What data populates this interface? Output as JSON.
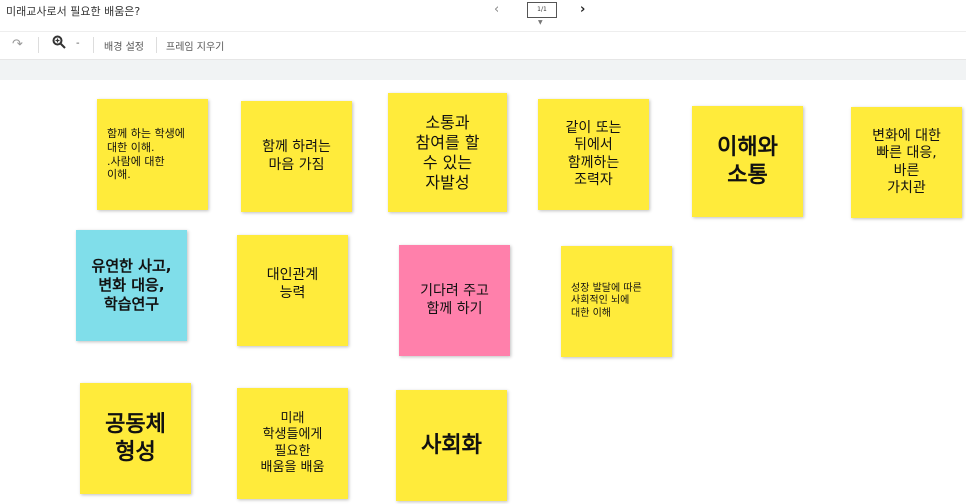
{
  "header": {
    "title": "미래교사로서 필요한 배움은?",
    "page_indicator": "1/1"
  },
  "toolbar": {
    "redo_icon": "redo-icon",
    "zoom_icon": "zoom-icon",
    "zoom_minus": "-",
    "background_label": "배경 설정",
    "clear_frame_label": "프레임 지우기"
  },
  "notes": [
    {
      "id": "n1",
      "text": "함께 하는 학생에\n대한 이해.\n.사람에 대한\n이해.",
      "color": "yellow"
    },
    {
      "id": "n2",
      "text": "함께 하려는\n마음 가짐",
      "color": "yellow"
    },
    {
      "id": "n3",
      "text": "소통과\n참여를 할\n수 있는\n자발성",
      "color": "yellow"
    },
    {
      "id": "n4",
      "text": "같이 또는\n뒤에서\n함께하는\n조력자",
      "color": "yellow"
    },
    {
      "id": "n5",
      "text": "이해와\n소통",
      "color": "yellow"
    },
    {
      "id": "n6",
      "text": "변화에 대한\n빠른 대응,\n바른\n가치관",
      "color": "yellow"
    },
    {
      "id": "n7",
      "text": "유연한 사고,\n변화 대응,\n학습연구",
      "color": "blue"
    },
    {
      "id": "n8",
      "text": "대인관계\n능력",
      "color": "yellow"
    },
    {
      "id": "n9",
      "text": "기다려 주고\n함께 하기",
      "color": "pink"
    },
    {
      "id": "n10",
      "text": "성장 발달에 따른\n사회적인 뇌에\n대한 이해",
      "color": "yellow"
    },
    {
      "id": "n11",
      "text": "공동체\n형성",
      "color": "yellow"
    },
    {
      "id": "n12",
      "text": "미래\n학생들에게\n필요한\n배움을 배움",
      "color": "yellow"
    },
    {
      "id": "n13",
      "text": "사회화",
      "color": "yellow"
    }
  ]
}
